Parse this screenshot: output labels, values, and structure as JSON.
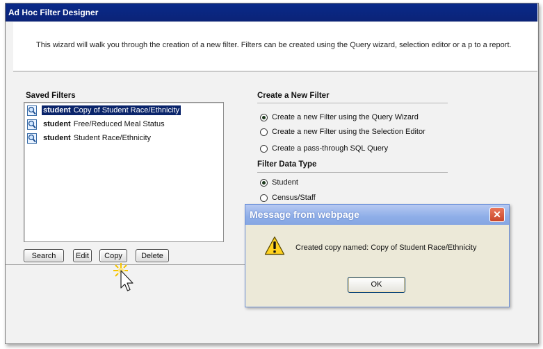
{
  "window": {
    "title": "Ad Hoc Filter Designer"
  },
  "intro": {
    "text": "This wizard will walk you through the creation of a new filter. Filters can be created using the Query wizard, selection editor or a p to a report."
  },
  "saved_filters": {
    "title": "Saved Filters",
    "items": [
      {
        "type": "student",
        "name": "Copy of Student Race/Ethnicity",
        "selected": true
      },
      {
        "type": "student",
        "name": "Free/Reduced Meal Status",
        "selected": false
      },
      {
        "type": "student",
        "name": "Student Race/Ethnicity",
        "selected": false
      }
    ],
    "buttons": {
      "search": "Search",
      "edit": "Edit",
      "copy": "Copy",
      "delete": "Delete"
    }
  },
  "create_filter": {
    "title": "Create a New Filter",
    "options": [
      {
        "label": "Create a new Filter using the Query Wizard",
        "checked": true
      },
      {
        "label": "Create a new Filter using the Selection Editor",
        "checked": false
      },
      {
        "label": "Create a pass-through SQL Query",
        "checked": false
      }
    ]
  },
  "filter_data_type": {
    "title": "Filter Data Type",
    "options": [
      {
        "label": "Student",
        "checked": true
      },
      {
        "label": "Census/Staff",
        "checked": false
      }
    ]
  },
  "dialog": {
    "title": "Message from webpage",
    "message": "Created copy named: Copy of Student Race/Ethnicity",
    "ok_label": "OK",
    "close_glyph": "✕",
    "warning_glyph": "!"
  },
  "icons": {
    "query_icon": "magnifier-document-icon",
    "warning_icon": "warning-triangle-icon",
    "cursor": "pointer-cursor-icon"
  }
}
